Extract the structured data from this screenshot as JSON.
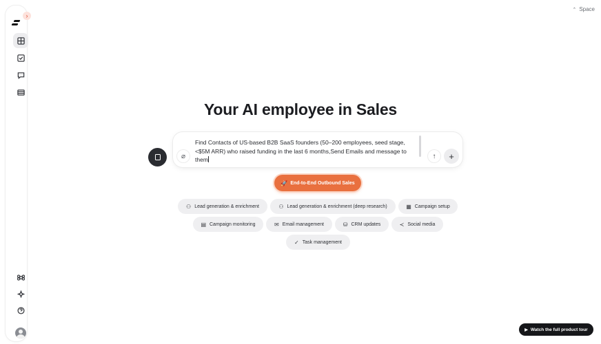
{
  "topbar": {
    "space_label": "Space",
    "space_icon": "chevron-up-icon"
  },
  "sidebar": {
    "expand_icon": "›",
    "top_items": [
      {
        "name": "dashboard",
        "icon": "grid-icon",
        "active": true
      },
      {
        "name": "tasks",
        "icon": "checkbox-icon",
        "active": false
      },
      {
        "name": "chat",
        "icon": "message-icon",
        "active": false
      },
      {
        "name": "table",
        "icon": "table-icon",
        "active": false
      }
    ],
    "bottom_items": [
      {
        "name": "shortcuts",
        "icon": "command-icon"
      },
      {
        "name": "ai-magic",
        "icon": "sparkle-icon"
      },
      {
        "name": "help",
        "icon": "help-icon"
      }
    ]
  },
  "hero": {
    "title": "Your AI employee in Sales"
  },
  "prompt": {
    "text": "Find Contacts of US-based B2B SaaS founders (50–200 employees, seed stage, <$5M ARR) who raised funding in the last 6 months,Send Emails and message to them"
  },
  "cta": {
    "label": "End-to-End Outbound Sales",
    "icon": "rocket-icon"
  },
  "chips": [
    {
      "label": "Lead generation & enrichment",
      "icon": "users-icon"
    },
    {
      "label": "Lead generation & enrichment (deep research)",
      "icon": "users-icon"
    },
    {
      "label": "Campaign setup",
      "icon": "calendar-icon"
    },
    {
      "label": "Campaign monitoring",
      "icon": "chart-icon"
    },
    {
      "label": "Email management",
      "icon": "mail-icon"
    },
    {
      "label": "CRM updates",
      "icon": "database-icon"
    },
    {
      "label": "Social media",
      "icon": "share-icon"
    },
    {
      "label": "Task management",
      "icon": "check-circle-icon"
    }
  ],
  "tour": {
    "label": "Watch the full product tour",
    "icon": "play-icon"
  },
  "colors": {
    "accent": "#e9703f",
    "dark": "#16171a",
    "chip_bg": "#efeff1"
  }
}
